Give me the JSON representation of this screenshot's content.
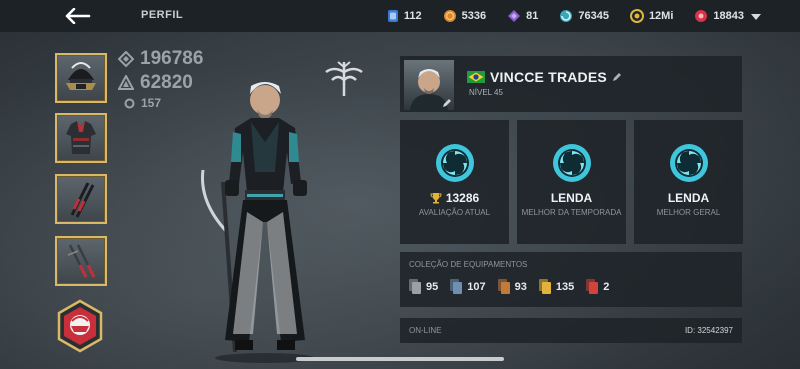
{
  "header": {
    "title": "PERFIL",
    "back_icon": "back-arrow-icon",
    "menu_icon": "chevron-down-icon",
    "currencies": [
      {
        "icon": "card-icon",
        "value": "112",
        "color": "#3b7bd6"
      },
      {
        "icon": "coin-icon",
        "value": "5336",
        "color": "#d8872a"
      },
      {
        "icon": "gem-icon",
        "value": "81",
        "color": "#8a5fd0"
      },
      {
        "icon": "swirl-icon",
        "value": "76345",
        "color": "#3aa6b8"
      },
      {
        "icon": "gold-coin-icon",
        "value": "12Mi",
        "color": "#e0b63a"
      },
      {
        "icon": "ruby-icon",
        "value": "18843",
        "color": "#d6344a"
      }
    ]
  },
  "equipment": {
    "slots": [
      "helmet-icon",
      "armor-icon",
      "ranged-weapon-icon",
      "melee-weapon-icon"
    ],
    "special_button": "shield-hex-icon"
  },
  "stats": {
    "total_power": "196786",
    "equipment_power": "62820",
    "level_power": "157"
  },
  "profile": {
    "name": "VINCCE TRADES",
    "level": "NÍVEL 45",
    "flag": "brazil-flag-icon"
  },
  "ranks": [
    {
      "value": "13286",
      "label": "AVALIAÇÃO ATUAL",
      "has_trophy": true
    },
    {
      "value": "LENDA",
      "label": "MELHOR DA TEMPORADA",
      "has_trophy": false
    },
    {
      "value": "LENDA",
      "label": "MELHOR GERAL",
      "has_trophy": false
    }
  ],
  "collection": {
    "title": "COLEÇÃO DE EQUIPAMENTOS",
    "items": [
      {
        "value": "95",
        "color": "#9aa1a6"
      },
      {
        "value": "107",
        "color": "#6f8fb0"
      },
      {
        "value": "93",
        "color": "#c27a3c"
      },
      {
        "value": "135",
        "color": "#e2b23a"
      },
      {
        "value": "2",
        "color": "#d0443a"
      }
    ]
  },
  "status": {
    "online": "ON-LINE",
    "id": "ID: 32542397"
  },
  "colors": {
    "accent_gold": "#d9b867",
    "panel_bg": "#1e2328",
    "rank_teal": "#3fc6dc"
  }
}
